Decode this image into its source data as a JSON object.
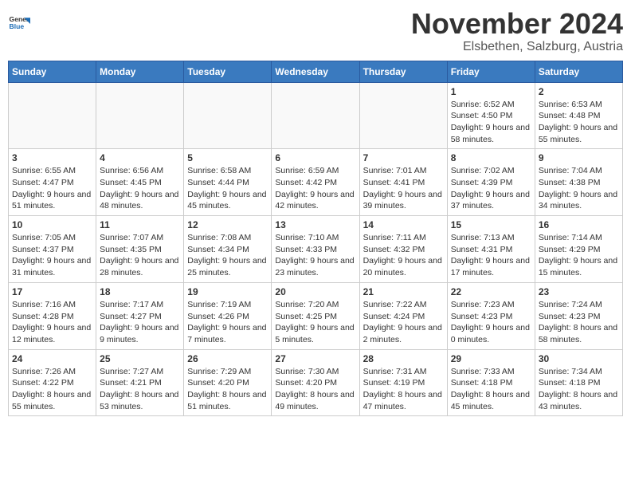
{
  "logo": {
    "general": "General",
    "blue": "Blue"
  },
  "header": {
    "month": "November 2024",
    "location": "Elsbethen, Salzburg, Austria"
  },
  "weekdays": [
    "Sunday",
    "Monday",
    "Tuesday",
    "Wednesday",
    "Thursday",
    "Friday",
    "Saturday"
  ],
  "weeks": [
    [
      {
        "day": "",
        "info": ""
      },
      {
        "day": "",
        "info": ""
      },
      {
        "day": "",
        "info": ""
      },
      {
        "day": "",
        "info": ""
      },
      {
        "day": "",
        "info": ""
      },
      {
        "day": "1",
        "info": "Sunrise: 6:52 AM\nSunset: 4:50 PM\nDaylight: 9 hours and 58 minutes."
      },
      {
        "day": "2",
        "info": "Sunrise: 6:53 AM\nSunset: 4:48 PM\nDaylight: 9 hours and 55 minutes."
      }
    ],
    [
      {
        "day": "3",
        "info": "Sunrise: 6:55 AM\nSunset: 4:47 PM\nDaylight: 9 hours and 51 minutes."
      },
      {
        "day": "4",
        "info": "Sunrise: 6:56 AM\nSunset: 4:45 PM\nDaylight: 9 hours and 48 minutes."
      },
      {
        "day": "5",
        "info": "Sunrise: 6:58 AM\nSunset: 4:44 PM\nDaylight: 9 hours and 45 minutes."
      },
      {
        "day": "6",
        "info": "Sunrise: 6:59 AM\nSunset: 4:42 PM\nDaylight: 9 hours and 42 minutes."
      },
      {
        "day": "7",
        "info": "Sunrise: 7:01 AM\nSunset: 4:41 PM\nDaylight: 9 hours and 39 minutes."
      },
      {
        "day": "8",
        "info": "Sunrise: 7:02 AM\nSunset: 4:39 PM\nDaylight: 9 hours and 37 minutes."
      },
      {
        "day": "9",
        "info": "Sunrise: 7:04 AM\nSunset: 4:38 PM\nDaylight: 9 hours and 34 minutes."
      }
    ],
    [
      {
        "day": "10",
        "info": "Sunrise: 7:05 AM\nSunset: 4:37 PM\nDaylight: 9 hours and 31 minutes."
      },
      {
        "day": "11",
        "info": "Sunrise: 7:07 AM\nSunset: 4:35 PM\nDaylight: 9 hours and 28 minutes."
      },
      {
        "day": "12",
        "info": "Sunrise: 7:08 AM\nSunset: 4:34 PM\nDaylight: 9 hours and 25 minutes."
      },
      {
        "day": "13",
        "info": "Sunrise: 7:10 AM\nSunset: 4:33 PM\nDaylight: 9 hours and 23 minutes."
      },
      {
        "day": "14",
        "info": "Sunrise: 7:11 AM\nSunset: 4:32 PM\nDaylight: 9 hours and 20 minutes."
      },
      {
        "day": "15",
        "info": "Sunrise: 7:13 AM\nSunset: 4:31 PM\nDaylight: 9 hours and 17 minutes."
      },
      {
        "day": "16",
        "info": "Sunrise: 7:14 AM\nSunset: 4:29 PM\nDaylight: 9 hours and 15 minutes."
      }
    ],
    [
      {
        "day": "17",
        "info": "Sunrise: 7:16 AM\nSunset: 4:28 PM\nDaylight: 9 hours and 12 minutes."
      },
      {
        "day": "18",
        "info": "Sunrise: 7:17 AM\nSunset: 4:27 PM\nDaylight: 9 hours and 9 minutes."
      },
      {
        "day": "19",
        "info": "Sunrise: 7:19 AM\nSunset: 4:26 PM\nDaylight: 9 hours and 7 minutes."
      },
      {
        "day": "20",
        "info": "Sunrise: 7:20 AM\nSunset: 4:25 PM\nDaylight: 9 hours and 5 minutes."
      },
      {
        "day": "21",
        "info": "Sunrise: 7:22 AM\nSunset: 4:24 PM\nDaylight: 9 hours and 2 minutes."
      },
      {
        "day": "22",
        "info": "Sunrise: 7:23 AM\nSunset: 4:23 PM\nDaylight: 9 hours and 0 minutes."
      },
      {
        "day": "23",
        "info": "Sunrise: 7:24 AM\nSunset: 4:23 PM\nDaylight: 8 hours and 58 minutes."
      }
    ],
    [
      {
        "day": "24",
        "info": "Sunrise: 7:26 AM\nSunset: 4:22 PM\nDaylight: 8 hours and 55 minutes."
      },
      {
        "day": "25",
        "info": "Sunrise: 7:27 AM\nSunset: 4:21 PM\nDaylight: 8 hours and 53 minutes."
      },
      {
        "day": "26",
        "info": "Sunrise: 7:29 AM\nSunset: 4:20 PM\nDaylight: 8 hours and 51 minutes."
      },
      {
        "day": "27",
        "info": "Sunrise: 7:30 AM\nSunset: 4:20 PM\nDaylight: 8 hours and 49 minutes."
      },
      {
        "day": "28",
        "info": "Sunrise: 7:31 AM\nSunset: 4:19 PM\nDaylight: 8 hours and 47 minutes."
      },
      {
        "day": "29",
        "info": "Sunrise: 7:33 AM\nSunset: 4:18 PM\nDaylight: 8 hours and 45 minutes."
      },
      {
        "day": "30",
        "info": "Sunrise: 7:34 AM\nSunset: 4:18 PM\nDaylight: 8 hours and 43 minutes."
      }
    ]
  ]
}
